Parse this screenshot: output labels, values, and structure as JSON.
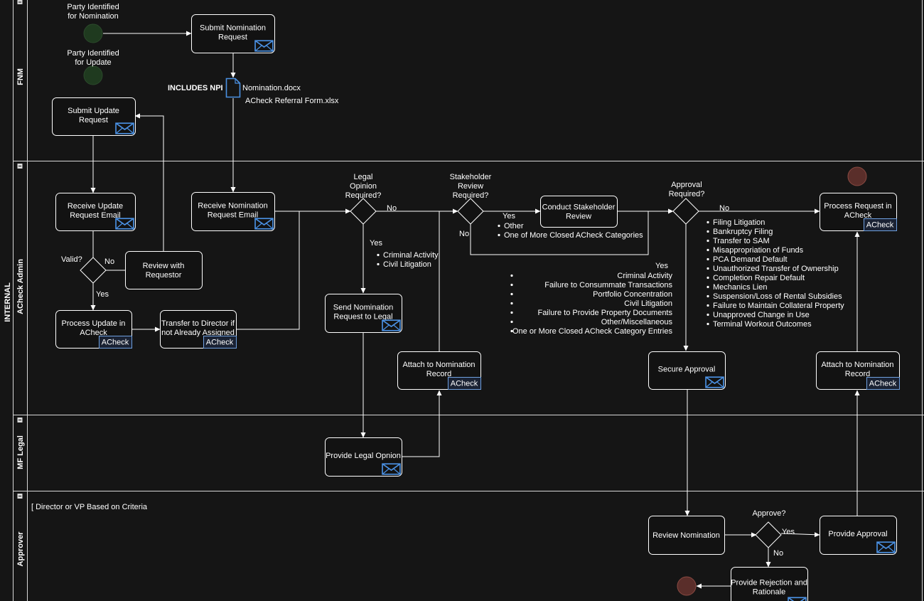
{
  "pool": {
    "label": "INTERNAL"
  },
  "lanes": [
    {
      "id": "fnm",
      "label": "FNM"
    },
    {
      "id": "admin",
      "label": "ACheck Admin"
    },
    {
      "id": "legal",
      "label": "MF Legal"
    },
    {
      "id": "approver",
      "label": "Approver"
    }
  ],
  "events": {
    "start_nomination": "Party Identified for Nomination",
    "start_update": "Party Identified for Update"
  },
  "tasks": {
    "submit_nomination": "Submit Nomination Request",
    "submit_update": "Submit Update Request",
    "receive_update": "Receive Update Request Email",
    "review_requestor": "Review with Requestor",
    "process_update": "Process Update in ACheck",
    "transfer_director": "Transfer to Director if not Already Assigned",
    "receive_nomination": "Receive Nomination Request Email",
    "send_legal": "Send Nomination Request to Legal",
    "attach_record_1": "Attach to Nomination Record",
    "provide_legal": "Provide Legal Opnion",
    "conduct_review": "Conduct Stakeholder Review",
    "secure_approval": "Secure Approval",
    "process_request": "Process Request in ACheck",
    "attach_record_2": "Attach to Nomination Record",
    "review_nomination": "Review Nomination",
    "provide_approval": "Provide Approval",
    "provide_rejection": "Provide Rejection and Rationale"
  },
  "system_tag": "ACheck",
  "gateways": {
    "valid": "Valid?",
    "legal": "Legal Opinion Required?",
    "stakeholder": "Stakeholder Review Required?",
    "approval": "Approval Required?",
    "approve": "Approve?"
  },
  "labels": {
    "yes": "Yes",
    "no": "No"
  },
  "documents": {
    "npi": "INCLUDES NPI",
    "file1": "Nomination.docx",
    "file2": "ACheck Referral Form.xlsx"
  },
  "annotation": "[ Director or VP Based on Criteria",
  "legal_criteria": [
    "Criminal Activity",
    "Civil Litigation"
  ],
  "stakeholder_criteria": [
    "Other",
    "One of More Closed ACheck Categories"
  ],
  "approval_yes_criteria": [
    "Criminal Activity",
    "Failure to Consummate Transactions",
    "Portfolio Concentration",
    "Civil Litigation",
    "Failure to Provide Property Documents",
    "Other/Miscellaneous",
    "One or More Closed ACheck Category Entries"
  ],
  "approval_no_criteria": [
    "Filing Litigation",
    "Bankruptcy Filing",
    "Transfer to SAM",
    "Misappropriation of Funds",
    "PCA Demand Default",
    "Unauthorized Transfer of Ownership",
    "Completion Repair Default",
    "Mechanics Lien",
    "Suspension/Loss of Rental Subsidies",
    "Failure to Maintain Collateral Property",
    "Unapproved Change in Use",
    "Terminal Workout Outcomes"
  ],
  "colors": {
    "background": "#151515",
    "start_event": "#1f3a1f",
    "end_event": "#5a2e2a",
    "envelope": "#4a90e2",
    "tag_border": "#6fa0e0"
  }
}
